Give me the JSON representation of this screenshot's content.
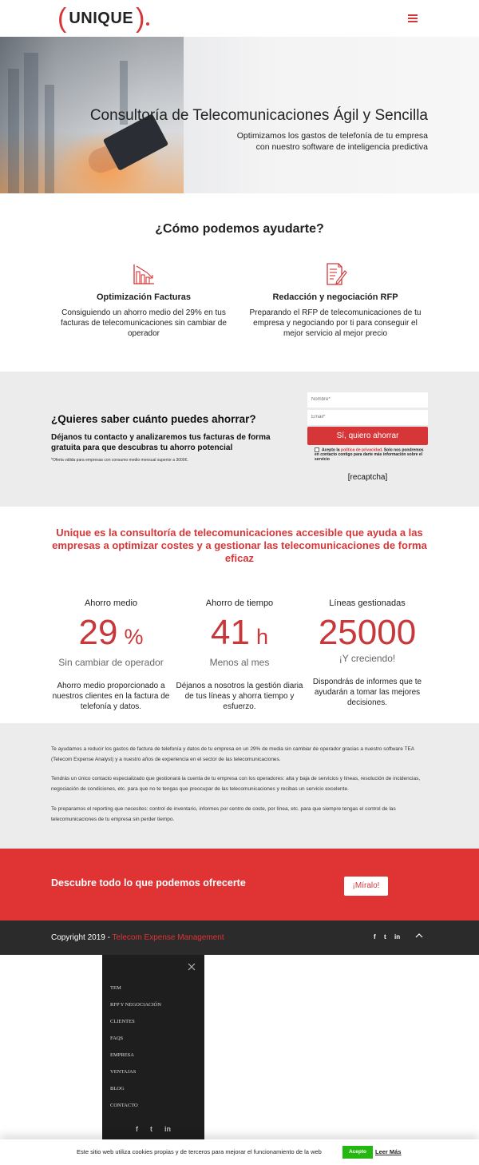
{
  "colors": {
    "accent": "#d63638",
    "footer_bg": "#2b2b2b",
    "section_bg": "#ececec",
    "cta_bg": "#e03334",
    "accept_green": "#23b80f"
  },
  "header": {
    "logo_text": "UNIQUE",
    "menu_icon": "hamburger-icon"
  },
  "hero": {
    "title": "Consultoría de Telecomunicaciones Ágil y Sencilla",
    "subtitle_line1": "Optimizamos los gastos de telefonía de tu empresa",
    "subtitle_line2": "con nuestro software de inteligencia predictiva"
  },
  "services": {
    "title": "¿Cómo podemos ayudarte?",
    "items": [
      {
        "icon": "chart-down-icon",
        "title": "Optimización Facturas",
        "text": "Consiguiendo un ahorro medio del 29% en tus facturas de telecomunicaciones sin cambiar de operador"
      },
      {
        "icon": "document-edit-icon",
        "title": "Redacción y negociación RFP",
        "text": "Preparando el RFP de telecomunicaciones de tu empresa y negociando por ti para conseguir el mejor servicio al mejor precio"
      }
    ]
  },
  "savings": {
    "title": "¿Quieres saber cuánto puedes ahorrar?",
    "lead": "Déjanos tu contacto y analizaremos tus facturas de forma gratuita para que descubras tu ahorro potencial",
    "note": "*Oferta válida para empresas con consumo medio mensual superior a 3000€.",
    "name_placeholder": "Nombre*",
    "email_placeholder": "Email*",
    "submit_label": "Sí, quiero ahorrar",
    "consent_prefix": "Acepto la",
    "consent_link": "política de privacidad",
    "consent_suffix": ". Solo nos pondremos en contacto contigo para darte más información sobre el servicio",
    "recaptcha": "[recaptcha]"
  },
  "headline": "Unique es la consultoría de telecomunicaciones accesible que ayuda a las empresas a optimizar costes y a gestionar las telecomunicaciones de forma eficaz",
  "stats": [
    {
      "label": "Ahorro medio",
      "value": "29",
      "unit": "%",
      "caption": "Sin cambiar de operador",
      "desc": "Ahorro medio proporcionado a nuestros clientes en la factura de telefonía y datos."
    },
    {
      "label": "Ahorro de tiempo",
      "value": "41",
      "unit": "h",
      "caption": "Menos al mes",
      "desc": "Déjanos a nosotros la gestión diaria de tus líneas y ahorra tiempo y esfuerzo."
    },
    {
      "label": "Líneas gestionadas",
      "value": "25000",
      "unit": "",
      "caption": "¡Y creciendo!",
      "desc": "Dispondrás de informes que te ayudarán a tomar las mejores decisiones."
    }
  ],
  "info": {
    "p1": "Te ayudamos a reducir los gastos de factura de telefonía y datos de tu empresa en un 29% de media sin cambiar de operador gracias a nuestro software TEA (Telecom Expense Analyst) y a nuestro años de experiencia en el sector de las telecomunicaciones.",
    "p2": "Tendrás un único contacto especializado que gestionará la cuenta de tu empresa con los operadores: alta y baja de servicios y líneas, resolución de incidencias, negociación de condiciones, etc. para que no te tengas que preocupar de las telecomunicaciones y recibas un servicio excelente.",
    "p3": "Te preparamos el reporting que necesites: control de inventario, informes por centro de coste, por línea, etc. para que siempre tengas el control de las telecomunicaciones de tu empresa sin perder tiempo."
  },
  "cta": {
    "text": "Descubre todo lo que podemos ofrecerte",
    "button": "¡Míralo!"
  },
  "footer": {
    "copyright": "Copyright 2019 - ",
    "link": "Telecom Expense Management",
    "social": [
      "f",
      "t",
      "in"
    ]
  },
  "menu": {
    "items": [
      "TEM",
      "RFP Y NEGOCIACIÓN",
      "CLIENTES",
      "FAQS",
      "EMPRESA",
      "VENTAJAS",
      "BLOG",
      "CONTACTO"
    ],
    "social": [
      "f",
      "t",
      "in"
    ]
  },
  "cookie": {
    "text": "Este sitio web utiliza cookies propias y de terceros para mejorar el funcionamiento de la web",
    "accept": "Acepto",
    "more": "Leer Más"
  }
}
